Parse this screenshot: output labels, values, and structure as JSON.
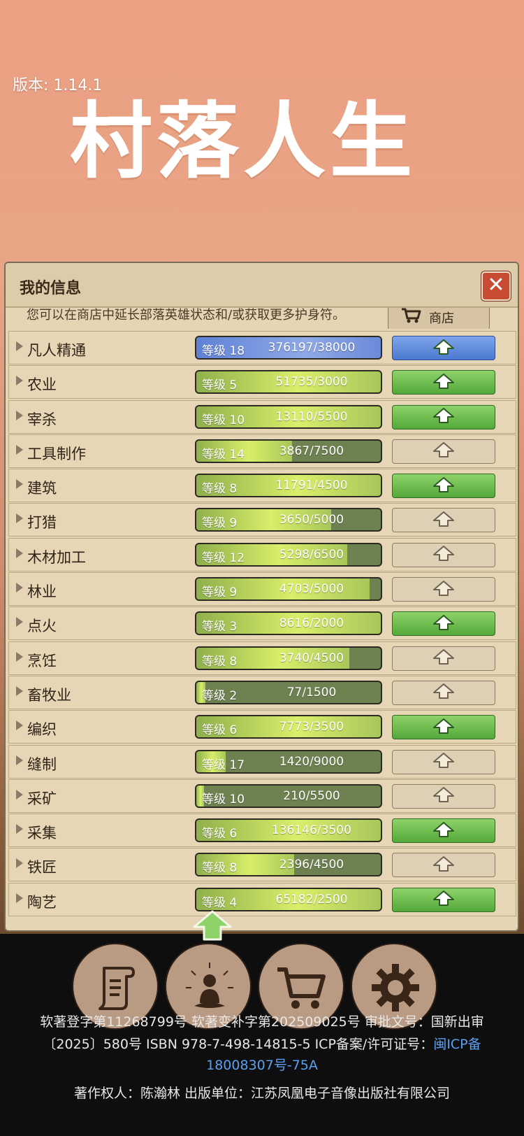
{
  "version": "版本: 1.14.1",
  "logo_text": "村落人生",
  "panel": {
    "title": "我的信息",
    "close_symbol": "✕",
    "notice": "您可以在商店中延长部落英雄状态和/或获取更多护身符。",
    "shop_label": "商店"
  },
  "skills": [
    {
      "name": "凡人精通",
      "level": "等级 18",
      "xp": "376197/38000",
      "progress": 1.0,
      "button": "blue"
    },
    {
      "name": "农业",
      "level": "等级 5",
      "xp": "51735/3000",
      "progress": 1.0,
      "button": "green"
    },
    {
      "name": "宰杀",
      "level": "等级 10",
      "xp": "13110/5500",
      "progress": 1.0,
      "button": "green"
    },
    {
      "name": "工具制作",
      "level": "等级 14",
      "xp": "3867/7500",
      "progress": 0.52,
      "button": "gray"
    },
    {
      "name": "建筑",
      "level": "等级 8",
      "xp": "11791/4500",
      "progress": 1.0,
      "button": "green"
    },
    {
      "name": "打猎",
      "level": "等级 9",
      "xp": "3650/5000",
      "progress": 0.73,
      "button": "gray"
    },
    {
      "name": "木材加工",
      "level": "等级 12",
      "xp": "5298/6500",
      "progress": 0.82,
      "button": "gray"
    },
    {
      "name": "林业",
      "level": "等级 9",
      "xp": "4703/5000",
      "progress": 0.94,
      "button": "gray"
    },
    {
      "name": "点火",
      "level": "等级 3",
      "xp": "8616/2000",
      "progress": 1.0,
      "button": "green"
    },
    {
      "name": "烹饪",
      "level": "等级 8",
      "xp": "3740/4500",
      "progress": 0.83,
      "button": "gray"
    },
    {
      "name": "畜牧业",
      "level": "等级 2",
      "xp": "77/1500",
      "progress": 0.05,
      "button": "gray"
    },
    {
      "name": "编织",
      "level": "等级 6",
      "xp": "7773/3500",
      "progress": 1.0,
      "button": "green"
    },
    {
      "name": "缝制",
      "level": "等级 17",
      "xp": "1420/9000",
      "progress": 0.16,
      "button": "gray"
    },
    {
      "name": "采矿",
      "level": "等级 10",
      "xp": "210/5500",
      "progress": 0.04,
      "button": "gray"
    },
    {
      "name": "采集",
      "level": "等级 6",
      "xp": "136146/3500",
      "progress": 1.0,
      "button": "green"
    },
    {
      "name": "铁匠",
      "level": "等级 8",
      "xp": "2396/4500",
      "progress": 0.53,
      "button": "gray"
    },
    {
      "name": "陶艺",
      "level": "等级 4",
      "xp": "65182/2500",
      "progress": 1.0,
      "button": "green"
    }
  ],
  "nav": [
    "scroll-icon",
    "meditate-icon",
    "cart-icon",
    "gear-icon"
  ],
  "footer": {
    "line1": "软著登字第11268799号 软著变补字第202509025号 审批文号：国新出审",
    "line2_prefix": "〔2025〕580号 ISBN 978-7-498-14815-5 ICP备案/许可证号：",
    "line2_link": "闽ICP备",
    "line3_link": "18008307号-75A",
    "line4": "著作权人：陈瀚林 出版单位：江苏凤凰电子音像出版社有限公司"
  },
  "colors": {
    "accent_green": "#54a83a",
    "accent_blue": "#4b78d0",
    "close_red": "#c84b33",
    "link_blue": "#5aa0f0"
  }
}
